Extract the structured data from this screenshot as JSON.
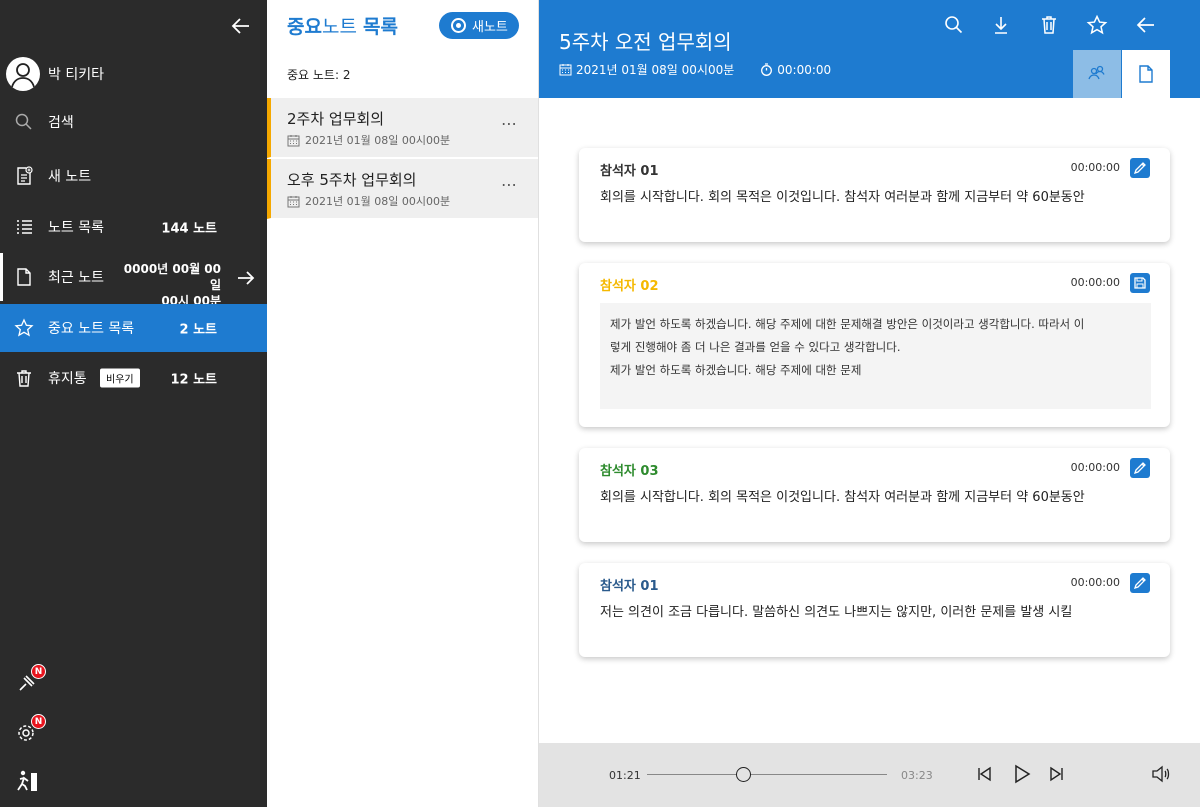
{
  "sidebar": {
    "username": "박 티키타",
    "items": [
      {
        "label": "검색"
      },
      {
        "label": "새 노트"
      },
      {
        "label": "노트 목록",
        "count": "144 노트"
      },
      {
        "label": "최근 노트",
        "date_line1": "0000년 00월 00일",
        "date_line2": "00시 00분"
      },
      {
        "label": "중요 노트 목록",
        "count": "2 노트"
      },
      {
        "label": "휴지통",
        "count": "12 노트",
        "empty_label": "비우기"
      }
    ],
    "badges": {
      "notification": "N",
      "settings": "N"
    }
  },
  "list": {
    "title_part1": "중요",
    "title_part2": "노트 ",
    "title_part3": "목록",
    "new_note_label": "새노트",
    "count_label": "중요 노트:",
    "count_value": "2",
    "notes": [
      {
        "title": "2주차 업무회의",
        "date": "2021년 01월 08일  00시00분"
      },
      {
        "title": "오후 5주차 업무회의",
        "date": "2021년 01월 08일  00시00분"
      }
    ]
  },
  "main": {
    "title": "5주차 오전 업무회의",
    "date": "2021년 01월 08일  00시00분",
    "duration": "00:00:00",
    "cards": [
      {
        "speaker": "참석자 01",
        "speaker_color": "#333333",
        "time": "00:00:00",
        "text": "회의를 시작합니다. 회의 목적은 이것입니다. 참석자 여러분과 함께 지금부터 약 60분동안"
      },
      {
        "speaker": "참석자 02",
        "speaker_color": "#f5b800",
        "time": "00:00:00",
        "edit_line1": "제가 발언 하도록 하겠습니다. 해당 주제에 대한 문제해결 방안은 이것이라고 생각합니다. 따라서 이",
        "edit_line2": "렇게 진행해야 좀 더 나은 결과를 얻을 수 있다고 생각합니다.",
        "edit_line3": "제가 발언 하도록 하겠습니다. 해당 주제에 대한 문제"
      },
      {
        "speaker": "참석자 03",
        "speaker_color": "#2e8b2e",
        "time": "00:00:00",
        "text": "회의를 시작합니다. 회의 목적은 이것입니다. 참석자 여러분과 함께 지금부터 약 60분동안"
      },
      {
        "speaker": "참석자 01",
        "speaker_color": "#2a5a8c",
        "time": "00:00:00",
        "text": "저는 의견이 조금 다릅니다. 말씀하신 의견도 나쁘지는 않지만, 이러한 문제를 발생 시킬"
      }
    ]
  },
  "player": {
    "current": "01:21",
    "duration": "03:23",
    "progress_fraction": 0.4
  },
  "colors": {
    "accent": "#1e7bd0",
    "sidebar": "#2b2b2b",
    "note_marker": "#f5a800"
  }
}
